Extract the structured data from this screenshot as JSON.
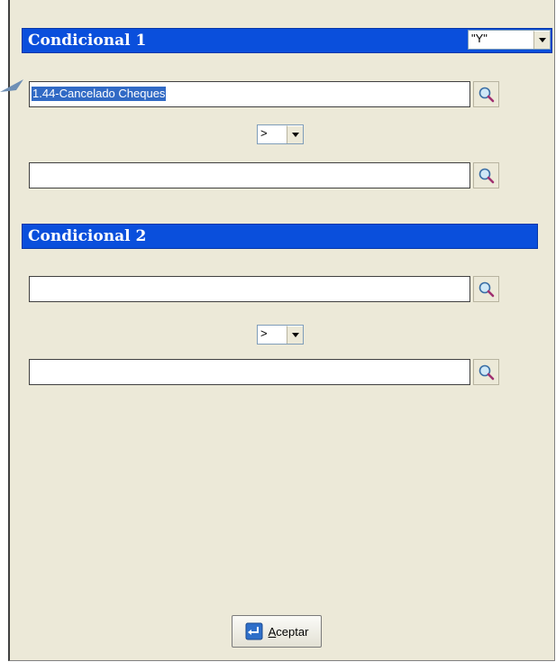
{
  "conditional1": {
    "title": "Condicional 1",
    "conjunction": "\"Y\"",
    "field1_value": "1.44-Cancelado Cheques",
    "operator": ">",
    "field2_value": ""
  },
  "conditional2": {
    "title": "Condicional 2",
    "field1_value": "",
    "operator": ">",
    "field2_value": ""
  },
  "accept_button": {
    "label": "Aceptar"
  },
  "colors": {
    "header_blue": "#0a4fdc",
    "panel_bg": "#ece9d8",
    "selection": "#316ac5"
  },
  "icons": {
    "lookup": "magnifier-lookup-icon",
    "accept": "enter-return-icon",
    "dropdown": "chevron-down-icon"
  }
}
